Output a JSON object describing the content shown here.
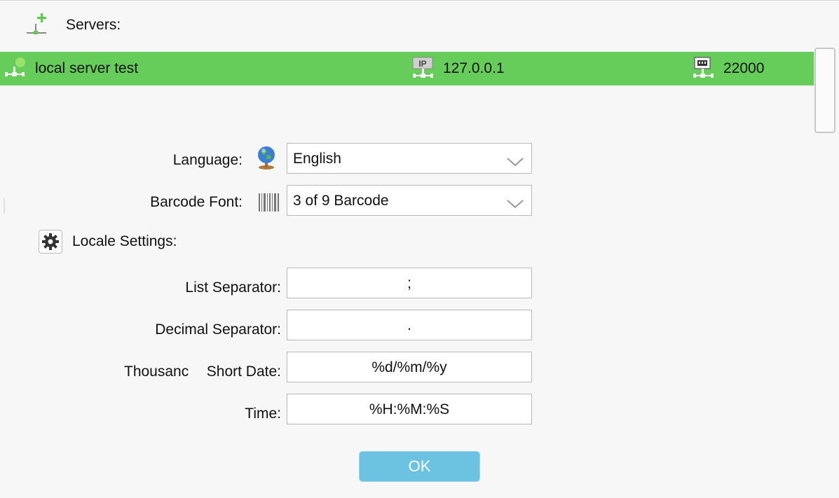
{
  "servers": {
    "label": "Servers:",
    "list": [
      {
        "name": "local server test",
        "ip": "127.0.0.1",
        "port": "22000",
        "status_color": "#66cc5a"
      }
    ]
  },
  "settings": {
    "language": {
      "label": "Language:",
      "value": "English",
      "icon": "globe-icon"
    },
    "barcode_font": {
      "label": "Barcode Font:",
      "value": "3 of 9 Barcode",
      "icon": "barcode-icon"
    },
    "locale": {
      "label": "Locale Settings:",
      "icon": "gear-icon",
      "list_separator": {
        "label": "List Separator:",
        "value": ";"
      },
      "decimal_separator": {
        "label": "Decimal Separator:",
        "value": "."
      },
      "thousand_label_clipped": "Thousanc",
      "short_date": {
        "label": "Short Date:",
        "value": "%d/%m/%y"
      },
      "time": {
        "label": "Time:",
        "value": "%H:%M:%S"
      }
    }
  },
  "ok_label": "OK",
  "colors": {
    "selected_row": "#66cc5a",
    "ok_button": "#6cc3e1"
  }
}
